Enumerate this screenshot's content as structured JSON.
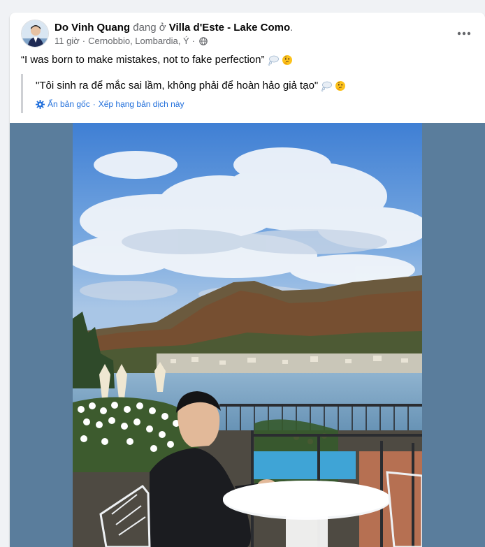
{
  "post": {
    "author": "Do Vinh Quang",
    "location_prefix": "đang ở",
    "location": "Villa d'Este - Lake Como",
    "location_suffix": ".",
    "time": "11 giờ",
    "separator": "·",
    "place": "Cernobbio, Lombardia, Ý",
    "audience_icon": "globe-icon",
    "more_icon": "more-horizontal-icon",
    "text": "“I was born to make mistakes, not to fake perfection”",
    "text_emojis": [
      "thought-bubble-emoji",
      "thinking-face-emoji"
    ]
  },
  "translation": {
    "text": "\"Tôi sinh ra để mắc sai lầm, không phải để hoàn hảo giả tạo\"",
    "emojis": [
      "thought-bubble-emoji",
      "thinking-face-emoji"
    ],
    "settings_icon": "gear-icon",
    "hide_original": "Ẩn bản gốc",
    "separator": "·",
    "rate": "Xếp hạng bản dịch này"
  },
  "photo": {
    "subject": "man in black sitting at white round table on terrace overlooking Lake Como with mountains and cloudy sky"
  },
  "colors": {
    "link": "#216fdb",
    "secondary_text": "#65676b",
    "media_background": "#5a7d9c",
    "page_background": "#f0f2f5"
  }
}
